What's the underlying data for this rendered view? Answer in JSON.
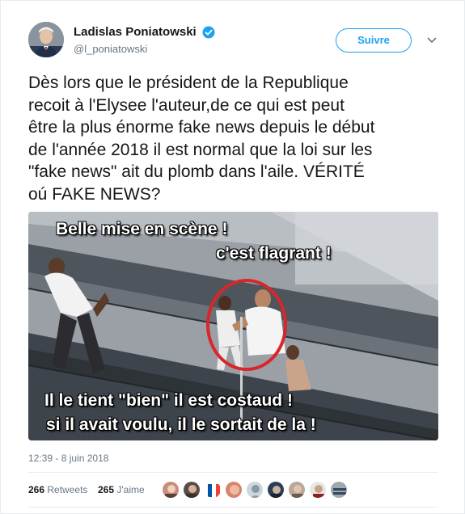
{
  "author": {
    "display_name": "Ladislas Poniatowski",
    "handle": "@l_poniatowski",
    "verified": true,
    "follow_label": "Suivre"
  },
  "tweet": {
    "lines": [
      "Dès lors que le président de la Republique",
      "recoit à  l'Elysee l'auteur,de ce qui est peut",
      "être la plus énorme fake news depuis le début",
      "de l'année 2018 il est normal que la loi sur les",
      "\"fake news\" ait du plomb dans l'aile. VÉRITÉ",
      "oú FAKE NEWS?"
    ],
    "timestamp": "12:39 - 8 juin 2018"
  },
  "media": {
    "captions": [
      "Belle mise en scène !",
      "c'est flagrant !",
      "Il le tient \"bien\" il est costaud !",
      "si il avait voulu, il le sortait de la !"
    ]
  },
  "stats": {
    "retweets_count": "266",
    "retweets_label": "Retweets",
    "likes_count": "265",
    "likes_label": "J'aime"
  },
  "colors": {
    "accent": "#1da1f2",
    "text": "#14171a",
    "muted": "#657786",
    "border": "#e6ecf0",
    "circle": "#d8262a"
  },
  "icons": {
    "verified": "verified-badge-icon",
    "chevron": "chevron-down-icon"
  }
}
